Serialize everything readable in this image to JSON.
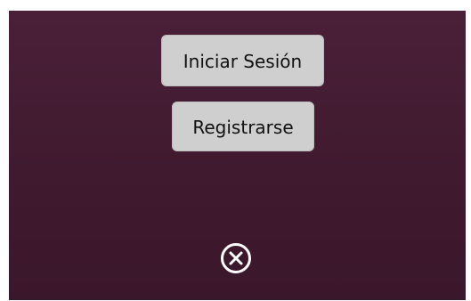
{
  "actions": {
    "login_label": "Iniciar Sesión",
    "register_label": "Registrarse"
  },
  "icons": {
    "close": "close-circle-icon"
  },
  "colors": {
    "panel_background": "#401a2f",
    "button_background": "#cfcfcf",
    "button_text": "#111111",
    "icon_color": "#ffffff"
  }
}
